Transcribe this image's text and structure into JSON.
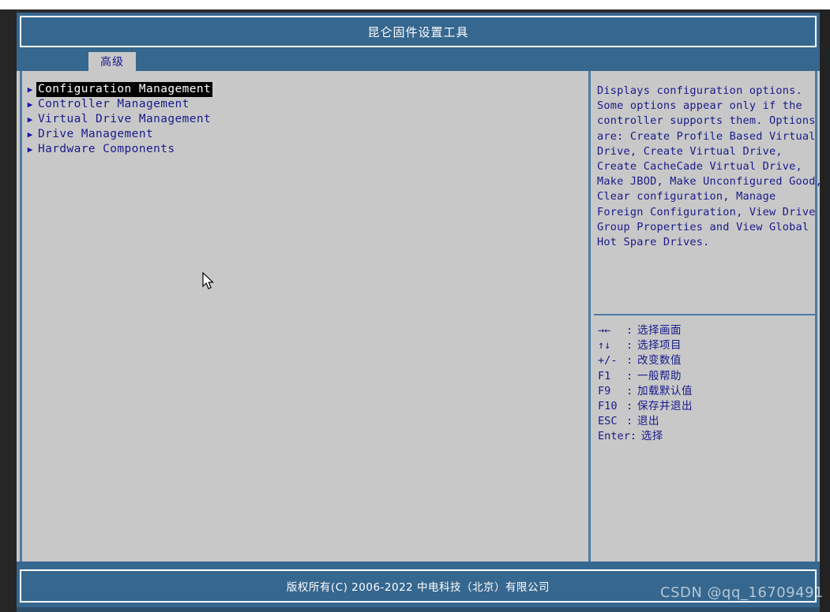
{
  "window": {
    "title": "昆仑固件设置工具"
  },
  "tabs": [
    {
      "label": "高级",
      "active": true
    }
  ],
  "menu": {
    "items": [
      {
        "label": "Configuration Management",
        "arrow": "right-triangle-icon",
        "selected": true
      },
      {
        "label": "Controller Management",
        "arrow": "right-triangle-icon",
        "selected": false
      },
      {
        "label": "Virtual Drive Management",
        "arrow": "right-triangle-icon",
        "selected": false
      },
      {
        "label": "Drive Management",
        "arrow": "right-triangle-icon",
        "selected": false
      },
      {
        "label": "Hardware Components",
        "arrow": "right-triangle-icon",
        "selected": false
      }
    ]
  },
  "help": {
    "lines": [
      "Displays configuration options.",
      "Some options appear only if the",
      "controller supports them. Options",
      "are: Create Profile Based Virtual",
      "Drive, Create Virtual Drive,",
      "Create CacheCade Virtual Drive,",
      "Make JBOD, Make Unconfigured Good,",
      "Clear configuration, Manage",
      "Foreign Configuration, View Drive",
      "Group Properties and View Global",
      "Hot Spare Drives."
    ]
  },
  "keys": {
    "rows": [
      {
        "key": "→←",
        "colon": ":",
        "desc": "选择画面"
      },
      {
        "key": "↑↓",
        "colon": ":",
        "desc": "选择项目"
      },
      {
        "key": "+/-",
        "colon": ":",
        "desc": "改变数值"
      },
      {
        "key": "F1",
        "colon": ":",
        "desc": "一般帮助"
      },
      {
        "key": "F9",
        "colon": ":",
        "desc": "加载默认值"
      },
      {
        "key": "F10",
        "colon": ":",
        "desc": "保存并退出"
      },
      {
        "key": "ESC",
        "colon": ":",
        "desc": "退出"
      },
      {
        "key": "Enter",
        "colon": ":",
        "desc": "选择"
      }
    ]
  },
  "footer": {
    "copyright": "版权所有(C) 2006-2022 中电科技（北京）有限公司"
  },
  "watermark": {
    "text": "CSDN @qq_16709491"
  },
  "colors": {
    "panel_blue": "#36678f",
    "body_gray": "#c8c8c8",
    "text_navy": "#1a1a8c",
    "divider_blue": "#4a7aa5",
    "highlight_bg": "#000000",
    "highlight_fg": "#ffffff"
  }
}
